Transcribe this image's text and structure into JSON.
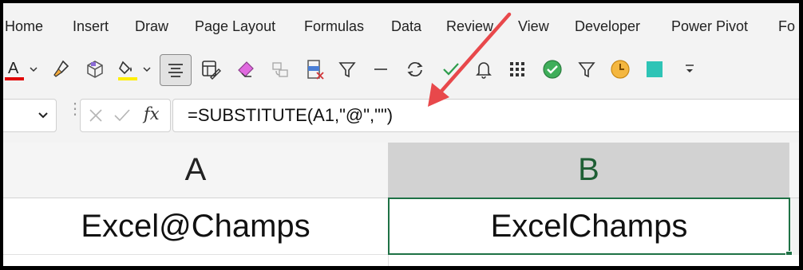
{
  "ribbon": {
    "tabs": [
      {
        "label": "Home"
      },
      {
        "label": "Insert"
      },
      {
        "label": "Draw"
      },
      {
        "label": "Page Layout"
      },
      {
        "label": "Formulas"
      },
      {
        "label": "Data"
      },
      {
        "label": "Review"
      },
      {
        "label": "View"
      },
      {
        "label": "Developer"
      },
      {
        "label": "Power Pivot"
      },
      {
        "label": "Fo"
      }
    ]
  },
  "toolbar": {
    "font_color_glyph": "A",
    "accent_red": "#e00000",
    "highlight_yellow": "#ffee00",
    "icons": [
      "font-color-icon",
      "format-painter-icon",
      "3d-box-icon",
      "fill-color-icon",
      "align-center-icon",
      "format-cells-icon",
      "eraser-icon",
      "convert-icon",
      "delete-rows-icon",
      "filter-icon",
      "minus-icon",
      "refresh-icon",
      "checkmark-icon",
      "bell-icon",
      "grid-icon",
      "check-circle-icon",
      "filter-outline-icon",
      "clock-icon",
      "teal-square-icon",
      "customize-toolbar-icon"
    ]
  },
  "formula_bar": {
    "fx_label": "fx",
    "formula": "=SUBSTITUTE(A1,\"@\",\"\")"
  },
  "grid": {
    "columns": [
      {
        "label": "A"
      },
      {
        "label": "B"
      }
    ],
    "cells": {
      "A1": "Excel@Champs",
      "B1": "ExcelChamps"
    },
    "selection_color": "#1e7145"
  },
  "annotation": {
    "arrow_color": "#e8484b"
  }
}
